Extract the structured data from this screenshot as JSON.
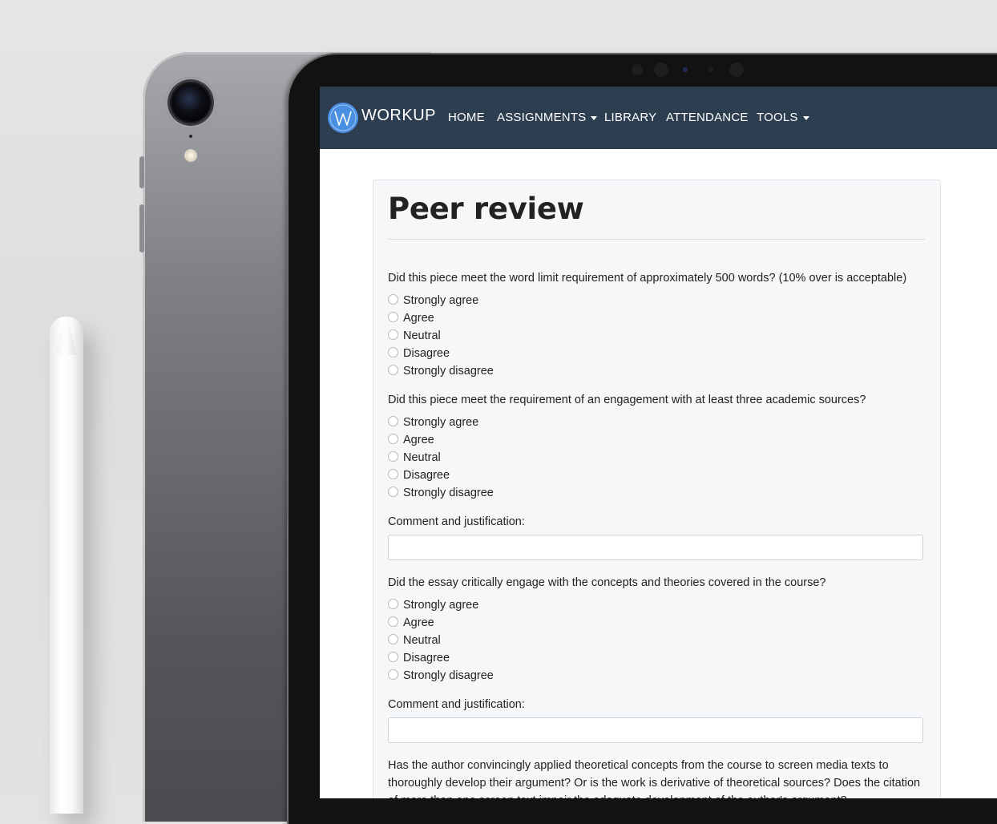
{
  "nav": {
    "brand": "WORKUP",
    "items": [
      {
        "label": "HOME",
        "dropdown": false
      },
      {
        "label": "ASSIGNMENTS",
        "dropdown": true
      },
      {
        "label": "LIBRARY",
        "dropdown": false
      },
      {
        "label": "ATTENDANCE",
        "dropdown": false
      },
      {
        "label": "TOOLS",
        "dropdown": true
      }
    ]
  },
  "page": {
    "title": "Peer review"
  },
  "options": [
    "Strongly agree",
    "Agree",
    "Neutral",
    "Disagree",
    "Strongly disagree"
  ],
  "questions": [
    {
      "text": "Did this piece meet the word limit requirement of approximately 500 words? (10% over is acceptable)"
    },
    {
      "text": "Did this piece meet the requirement of an engagement with at least three academic sources?"
    },
    {
      "text": "Did the essay critically engage with the concepts and theories covered in the course?"
    },
    {
      "text": "Has the author convincingly applied theoretical concepts from the course to screen media texts to thoroughly develop their argument? Or is the work is derivative of theoretical sources? Does the citation of more than one screen text impair the adequate development of the author's argument?"
    }
  ],
  "comment_label": "Comment and justification:",
  "colors": {
    "navbar": "#2d3e50",
    "brand_logo": "#4a90e2",
    "card_bg": "#f6f7f9"
  },
  "icons": {
    "brand": "w-logo-icon",
    "dropdown": "caret-down-icon"
  }
}
